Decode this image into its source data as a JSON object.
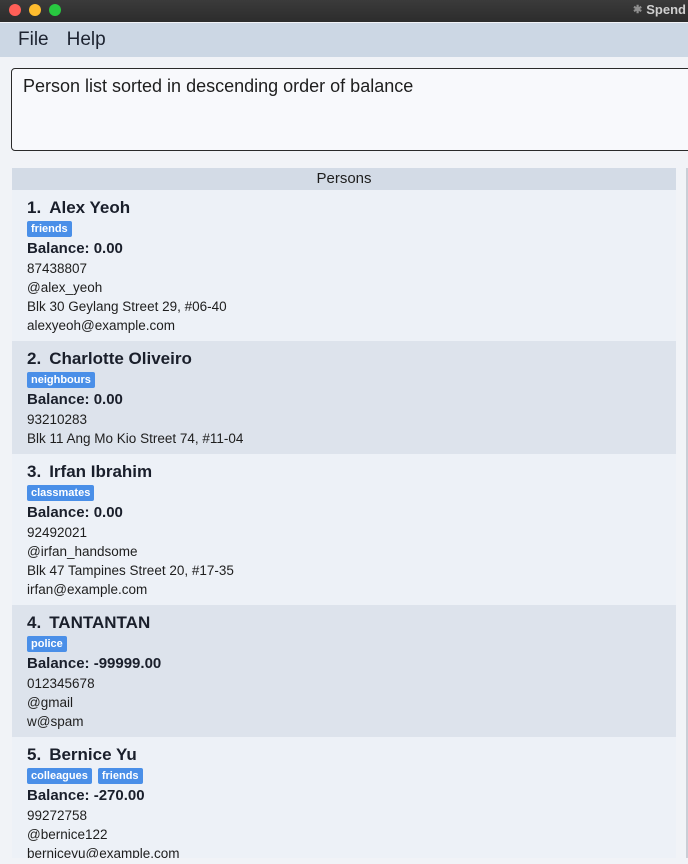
{
  "window": {
    "title": "Spend"
  },
  "menu": {
    "file": "File",
    "help": "Help"
  },
  "result": {
    "text": "Person list sorted in descending order of balance"
  },
  "list": {
    "header": "Persons",
    "persons": [
      {
        "index": "1.",
        "name": "Alex Yeoh",
        "tags": [
          "friends"
        ],
        "balance": "Balance: 0.00",
        "lines": [
          "87438807",
          "@alex_yeoh",
          "Blk 30 Geylang Street 29, #06-40",
          "alexyeoh@example.com"
        ]
      },
      {
        "index": "2.",
        "name": "Charlotte Oliveiro",
        "tags": [
          "neighbours"
        ],
        "balance": "Balance: 0.00",
        "lines": [
          "93210283",
          "Blk 11 Ang Mo Kio Street 74, #11-04"
        ]
      },
      {
        "index": "3.",
        "name": "Irfan Ibrahim",
        "tags": [
          "classmates"
        ],
        "balance": "Balance: 0.00",
        "lines": [
          "92492021",
          "@irfan_handsome",
          "Blk 47 Tampines Street 20, #17-35",
          "irfan@example.com"
        ]
      },
      {
        "index": "4.",
        "name": "TANTANTAN",
        "tags": [
          "police"
        ],
        "balance": "Balance: -99999.00",
        "lines": [
          "012345678",
          "@gmail",
          "w@spam"
        ]
      },
      {
        "index": "5.",
        "name": "Bernice Yu",
        "tags": [
          "colleagues",
          "friends"
        ],
        "balance": "Balance: -270.00",
        "lines": [
          "99272758",
          "@bernice122",
          "berniceyu@example.com"
        ]
      }
    ]
  }
}
